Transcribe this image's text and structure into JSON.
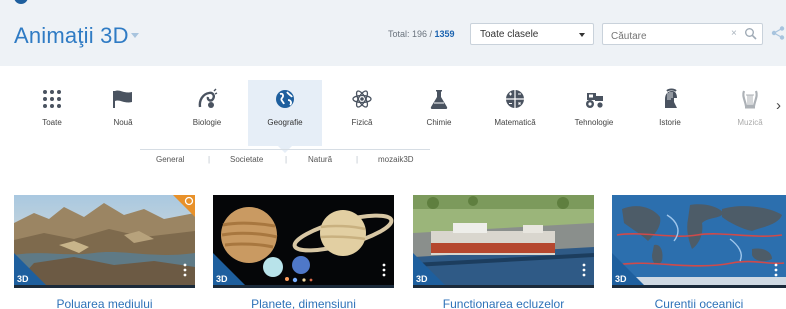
{
  "header": {
    "title": "Animaţii 3D",
    "total_prefix": "Total: 196 / ",
    "total_count": "1359",
    "class_select": "Toate clasele",
    "search_placeholder": "Căutare",
    "search_clear": "×"
  },
  "categories": [
    {
      "label": "Toate",
      "icon": "grid-icon"
    },
    {
      "label": "Nouă",
      "icon": "flag-icon"
    },
    {
      "label": "Biologie",
      "icon": "biology-icon"
    },
    {
      "label": "Geografie",
      "icon": "globe-icon",
      "active": true
    },
    {
      "label": "Fizică",
      "icon": "atom-icon"
    },
    {
      "label": "Chimie",
      "icon": "flask-icon"
    },
    {
      "label": "Matematică",
      "icon": "math-icon"
    },
    {
      "label": "Tehnologie",
      "icon": "tractor-icon"
    },
    {
      "label": "Istorie",
      "icon": "helmet-icon"
    },
    {
      "label": "Muzică",
      "icon": "lyre-icon"
    }
  ],
  "subnav": [
    "General",
    "Societate",
    "Natură",
    "mozaik3D"
  ],
  "cards": [
    {
      "title": "Poluarea mediului",
      "badge": "3D",
      "thumb": "landscape"
    },
    {
      "title": "Planete, dimensiuni",
      "badge": "3D",
      "thumb": "planets"
    },
    {
      "title": "Functionarea ecluzelor",
      "badge": "3D",
      "thumb": "lock"
    },
    {
      "title": "Curentii oceanici",
      "badge": "3D",
      "thumb": "ocean"
    }
  ],
  "colors": {
    "accent": "#2f7bc4",
    "brand_dark": "#1e5f9e",
    "badge_orange": "#e8912a"
  }
}
